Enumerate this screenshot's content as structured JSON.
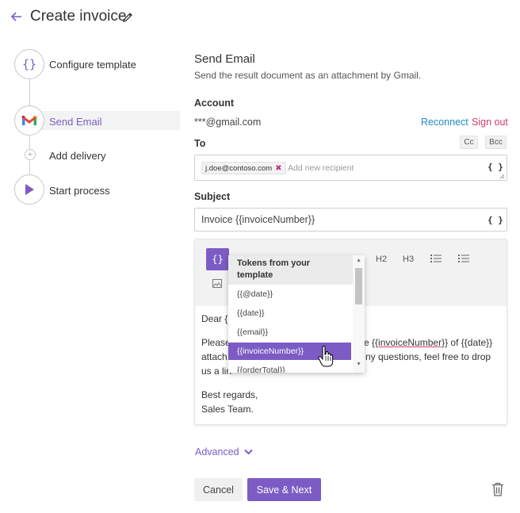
{
  "header": {
    "title": "Create invoice"
  },
  "steps": [
    {
      "label": "Configure template",
      "icon": "braces-icon"
    },
    {
      "label": "Send Email",
      "icon": "gmail-icon",
      "active": true
    },
    {
      "label": "Add delivery",
      "icon": "plus-icon"
    },
    {
      "label": "Start process",
      "icon": "play-icon"
    }
  ],
  "panel": {
    "title": "Send Email",
    "subtitle": "Send the result document as an attachment by Gmail.",
    "account_label": "Account",
    "account_value": "***@gmail.com",
    "reconnect": "Reconnect",
    "sign_out": "Sign out",
    "to_label": "To",
    "cc": "Cc",
    "bcc": "Bcc",
    "recipient_chip": "j.doe@contoso.com",
    "chip_remove": "✖",
    "recipient_placeholder": "Add new recipient",
    "subject_label": "Subject",
    "subject_value": "Invoice {{invoiceNumber}}",
    "braces": "{ }"
  },
  "editor": {
    "tokens_btn": "{}",
    "h2": "H2",
    "h3": "H3",
    "line1": "Dear {",
    "line2_a": "Please",
    "line2_b": "e ",
    "line2_token": "{{invoiceNumber}}",
    "line2_c": " of {{date}}",
    "line3_a": "attach",
    "line3_b": "ny questions, feel free to drop",
    "line4": "us a lin",
    "closing1": "Best regards,",
    "closing2": "Sales Team."
  },
  "dropdown": {
    "header": "Tokens from your template",
    "items": [
      "{{@date}}",
      "{{date}}",
      "{{email}}",
      "{{invoiceNumber}}",
      "{{orderTotal}}"
    ],
    "selected": "{{invoiceNumber}}"
  },
  "footer": {
    "advanced": "Advanced",
    "cancel": "Cancel",
    "save": "Save & Next"
  },
  "colors": {
    "accent": "#7c5cc4",
    "link": "#1f8ac7",
    "danger": "#d33a6a"
  }
}
